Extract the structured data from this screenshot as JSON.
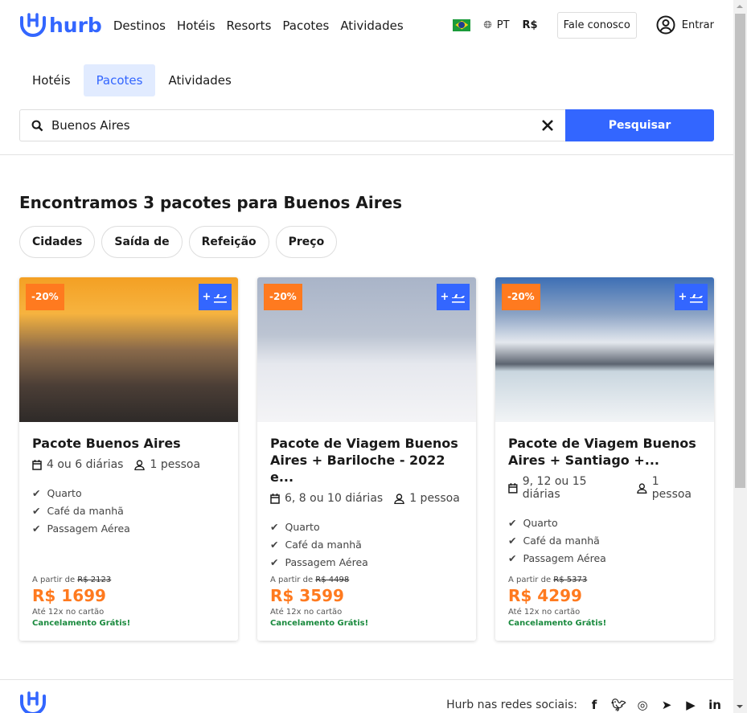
{
  "header": {
    "logo": "hurb",
    "nav": [
      "Destinos",
      "Hotéis",
      "Resorts",
      "Pacotes",
      "Atividades"
    ],
    "language": "PT",
    "currency": "R$",
    "contact": "Fale conosco",
    "login": "Entrar",
    "brand_color": "#3366ff"
  },
  "tabs": [
    {
      "label": "Hotéis",
      "active": false
    },
    {
      "label": "Pacotes",
      "active": true
    },
    {
      "label": "Atividades",
      "active": false
    }
  ],
  "search": {
    "value": "Buenos Aires",
    "button": "Pesquisar"
  },
  "results": {
    "heading": "Encontramos 3 pacotes para Buenos Aires",
    "filters": [
      "Cidades",
      "Saída de",
      "Refeição",
      "Preço"
    ]
  },
  "cards": [
    {
      "discount": "-20%",
      "plus": "+",
      "title": "Pacote Buenos Aires",
      "days": "4 ou 6 diárias",
      "people": "1 pessoa",
      "features": [
        "Quarto",
        "Café da manhã",
        "Passagem Aérea"
      ],
      "from_label": "A partir de",
      "old_price": "R$ 2123",
      "price": "R$ 1699",
      "installments": "Até 12x no cartão",
      "cancel": "Cancelamento Grátis!"
    },
    {
      "discount": "-20%",
      "plus": "+",
      "title": "Pacote de Viagem Buenos Aires + Bariloche - 2022 e...",
      "days": "6, 8 ou 10 diárias",
      "people": "1 pessoa",
      "features": [
        "Quarto",
        "Café da manhã",
        "Passagem Aérea"
      ],
      "from_label": "A partir de",
      "old_price": "R$ 4498",
      "price": "R$ 3599",
      "installments": "Até 12x no cartão",
      "cancel": "Cancelamento Grátis!"
    },
    {
      "discount": "-20%",
      "plus": "+",
      "title": "Pacote de Viagem Buenos Aires + Santiago +...",
      "days": "9, 12 ou 15 diárias",
      "people": "1 pessoa",
      "features": [
        "Quarto",
        "Café da manhã",
        "Passagem Aérea"
      ],
      "from_label": "A partir de",
      "old_price": "R$ 5373",
      "price": "R$ 4299",
      "installments": "Até 12x no cartão",
      "cancel": "Cancelamento Grátis!"
    }
  ],
  "footer": {
    "social_label": "Hurb nas redes sociais:",
    "social": [
      "facebook-icon",
      "twitter-icon",
      "instagram-icon",
      "telegram-icon",
      "youtube-icon",
      "linkedin-icon"
    ]
  }
}
